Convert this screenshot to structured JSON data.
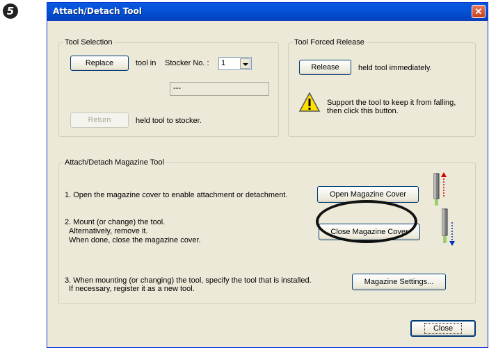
{
  "step_number": "5",
  "window": {
    "title": "Attach/Detach Tool",
    "close_glyph": "✕"
  },
  "tool_selection": {
    "label": "Tool Selection",
    "replace_button": "Replace",
    "tool_in_text": "tool in",
    "stocker_label": "Stocker No. :",
    "stocker_value": "1",
    "info_field": "---",
    "return_button": "Return",
    "return_text": "held tool to stocker."
  },
  "forced_release": {
    "label": "Tool Forced Release",
    "release_button": "Release",
    "release_text": "held tool immediately.",
    "warning_line1": "Support the tool to keep it from falling,",
    "warning_line2": "then click this button."
  },
  "magazine": {
    "label": "Attach/Detach Magazine Tool",
    "step1_text": "1. Open the magazine cover to enable attachment or detachment.",
    "open_cover_button": "Open Magazine Cover",
    "step2_line1": "2. Mount (or change) the tool.",
    "step2_line2": "Alternatively, remove it.",
    "step2_line3": "When done, close the magazine cover.",
    "close_cover_button": "Close Magazine Cover",
    "step3_line1": "3. When mounting (or changing) the tool, specify the tool that is installed.",
    "step3_line2": "If necessary, register it as a new tool.",
    "settings_button": "Magazine Settings..."
  },
  "footer": {
    "close_button": "Close"
  },
  "colors": {
    "titlebar": "#0147c8",
    "dialog_bg": "#ece9d8",
    "arrow_up": "#cc0000",
    "arrow_down": "#0030c0"
  }
}
